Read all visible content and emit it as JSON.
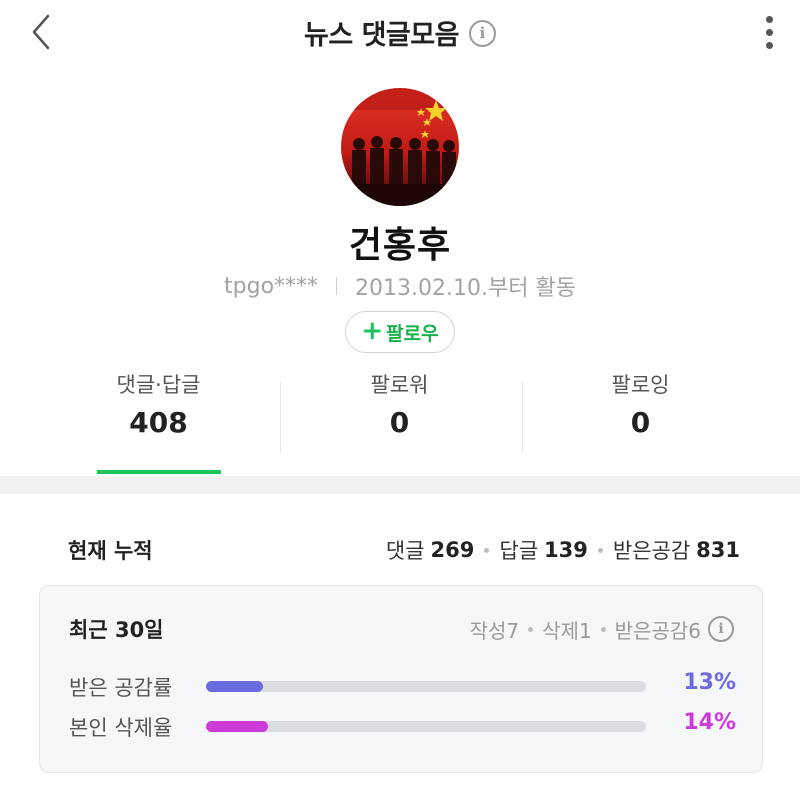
{
  "header": {
    "title": "뉴스 댓글모음",
    "info_glyph": "i",
    "back_icon": "chevron-left-icon",
    "more_icon": "more-vertical-icon"
  },
  "profile": {
    "name": "건홍후",
    "user_id": "tpgo****",
    "since": "2013.02.10.부터 활동",
    "follow": {
      "plus": "+",
      "label": "팔로우"
    }
  },
  "stats": [
    {
      "label": "댓글·답글",
      "value": "408",
      "active": true
    },
    {
      "label": "팔로워",
      "value": "0",
      "active": false
    },
    {
      "label": "팔로잉",
      "value": "0",
      "active": false
    }
  ],
  "cumulative": {
    "title": "현재 누적",
    "items": [
      {
        "label": "댓글",
        "value": "269"
      },
      {
        "label": "답글",
        "value": "139"
      },
      {
        "label": "받은공감",
        "value": "831"
      }
    ]
  },
  "recent": {
    "title": "최근 30일",
    "items": [
      "작성7",
      "삭제1",
      "받은공감6"
    ],
    "info_glyph": "i",
    "metrics": [
      {
        "label": "받은 공감률",
        "percent": "13%",
        "fraction": 0.13,
        "color": "#6b6be0"
      },
      {
        "label": "본인 삭제율",
        "percent": "14%",
        "fraction": 0.14,
        "color": "#cc3ad8"
      }
    ]
  },
  "colors": {
    "accent_green": "#1ec55a",
    "empathy": "#6b6be0",
    "delete": "#cc3ad8"
  }
}
